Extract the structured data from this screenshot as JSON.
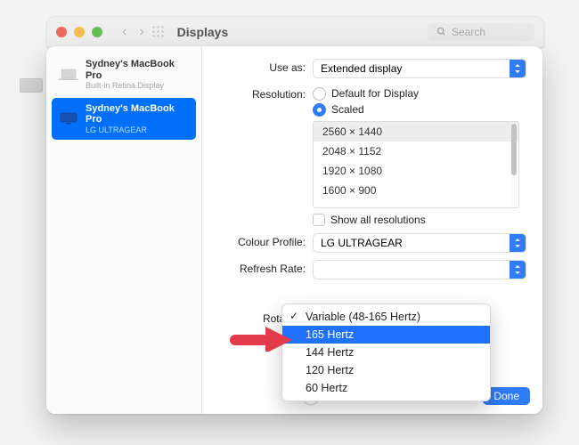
{
  "bg_window": {
    "title": "Displays",
    "search_placeholder": "Search"
  },
  "sidebar": {
    "items": [
      {
        "title": "Sydney's MacBook Pro",
        "sub": "Built-in Retina Display",
        "selected": false
      },
      {
        "title": "Sydney's MacBook Pro",
        "sub": "LG ULTRAGEAR",
        "selected": true
      }
    ]
  },
  "main": {
    "labels": {
      "use_as": "Use as:",
      "resolution": "Resolution:",
      "colour_profile": "Colour Profile:",
      "refresh_rate": "Refresh Rate:",
      "rotation": "Rotation:"
    },
    "use_as_value": "Extended display",
    "resolution": {
      "default": "Default for Display",
      "scaled": "Scaled",
      "selected": "scaled",
      "options": [
        "2560 × 1440",
        "2048 × 1152",
        "1920 × 1080",
        "1600 × 900"
      ],
      "selected_option_index": 0,
      "show_all": "Show all resolutions"
    },
    "colour_profile_value": "LG ULTRAGEAR",
    "refresh_rate_menu": {
      "items": [
        {
          "label": "Variable (48-165 Hertz)",
          "checked": true
        },
        {
          "label": "165 Hertz",
          "highlight": true
        },
        {
          "label": "144 Hertz"
        },
        {
          "label": "120 Hertz"
        },
        {
          "label": "60 Hertz"
        }
      ]
    },
    "help": "?",
    "done": "Done"
  }
}
